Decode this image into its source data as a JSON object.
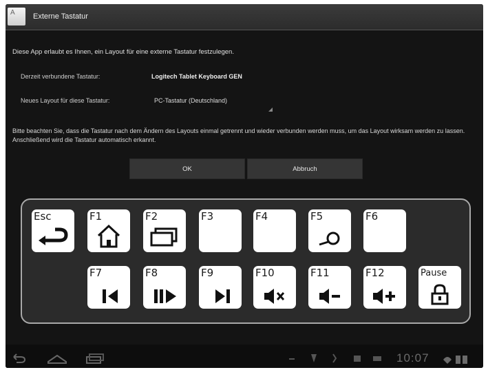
{
  "window": {
    "title": "Externe Tastatur",
    "app_icon": "keyboard-app-icon"
  },
  "description": "Diese App erlaubt es Ihnen, ein Layout für eine externe Tastatur festzulegen.",
  "connected": {
    "label": "Derzeit verbundene Tastatur:",
    "value": "Logitech Tablet Keyboard GEN"
  },
  "layout": {
    "label": "Neues Layout für diese Tastatur:",
    "value": "PC-Tastatur (Deutschland)"
  },
  "note": "Bitte beachten Sie, dass die Tastatur nach dem Ändern des Layouts einmal getrennt und wieder verbunden werden muss, um das Layout wirksam werden zu lassen. Anschließend wird die Tastatur automatisch erkannt.",
  "buttons": {
    "ok": "OK",
    "cancel": "Abbruch"
  },
  "keys": {
    "esc": {
      "label": "Esc",
      "icon": "back-arrow-icon"
    },
    "f1": {
      "label": "F1",
      "icon": "home-icon"
    },
    "f2": {
      "label": "F2",
      "icon": "recent-apps-icon"
    },
    "f3": {
      "label": "F3"
    },
    "f4": {
      "label": "F4"
    },
    "f5": {
      "label": "F5",
      "icon": "search-icon"
    },
    "f6": {
      "label": "F6"
    },
    "f7": {
      "label": "F7",
      "icon": "previous-track-icon"
    },
    "f8": {
      "label": "F8",
      "icon": "play-pause-icon"
    },
    "f9": {
      "label": "F9",
      "icon": "next-track-icon"
    },
    "f10": {
      "label": "F10",
      "icon": "mute-icon"
    },
    "f11": {
      "label": "F11",
      "icon": "volume-down-icon"
    },
    "f12": {
      "label": "F12",
      "icon": "volume-up-icon"
    },
    "pause": {
      "label": "Pause",
      "icon": "lock-icon"
    }
  },
  "statusbar": {
    "time": "10:07"
  },
  "colors": {
    "background": "#141414",
    "titlebar": "#333333",
    "button": "#353535",
    "key": "#ffffff"
  }
}
